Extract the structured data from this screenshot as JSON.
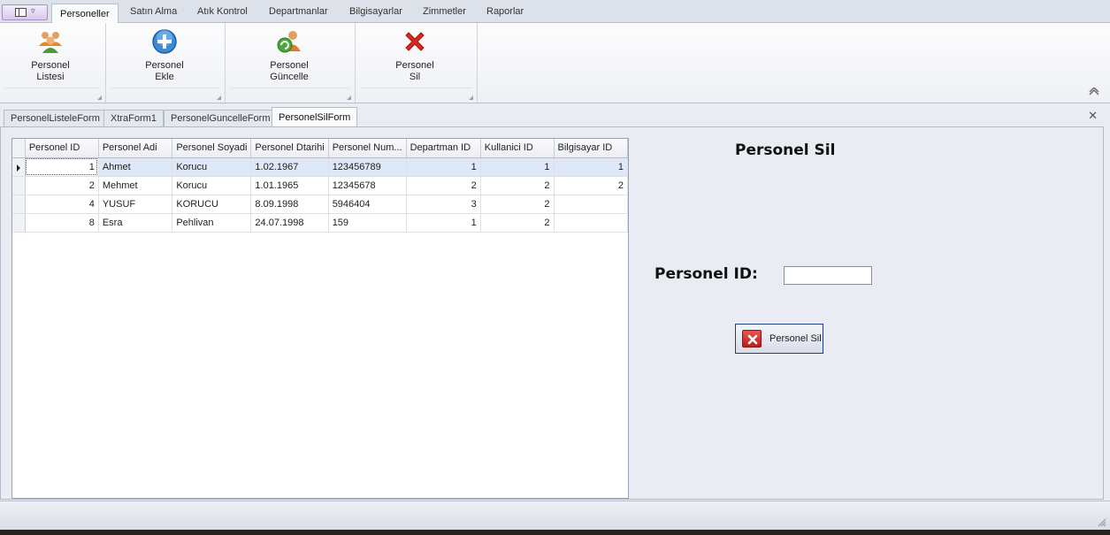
{
  "ribbon": {
    "tabs": [
      "Personeller",
      "Satın Alma",
      "Atık Kontrol",
      "Departmanlar",
      "Bilgisayarlar",
      "Zimmetler",
      "Raporlar"
    ],
    "active_tab": "Personeller",
    "buttons": [
      {
        "label": "Personel\nListesi",
        "icon": "users-icon"
      },
      {
        "label": "Personel\nEkle",
        "icon": "plus-circle-icon"
      },
      {
        "label": "Personel\nGüncelle",
        "icon": "user-refresh-icon"
      },
      {
        "label": "Personel\nSil",
        "icon": "delete-x-icon"
      }
    ]
  },
  "doc_tabs": [
    "PersonelListeleForm",
    "XtraForm1",
    "PersonelGuncelleForm",
    "PersonelSilForm"
  ],
  "active_doc_tab": "PersonelSilForm",
  "grid": {
    "columns": [
      "Personel ID",
      "Personel Adi",
      "Personel Soyadi",
      "Personel Dtarihi",
      "Personel Num...",
      "Departman ID",
      "Kullanici ID",
      "Bilgisayar ID"
    ],
    "rows": [
      [
        "1",
        "Ahmet",
        "Korucu",
        "1.02.1967",
        "123456789",
        "1",
        "1",
        "1"
      ],
      [
        "2",
        "Mehmet",
        "Korucu",
        "1.01.1965",
        "12345678",
        "2",
        "2",
        "2"
      ],
      [
        "4",
        "YUSUF",
        "KORUCU",
        "8.09.1998",
        "5946404",
        "3",
        "2",
        ""
      ],
      [
        "8",
        "Esra",
        "Pehlivan",
        "24.07.1998",
        "159",
        "1",
        "2",
        ""
      ]
    ],
    "selected_row": 0
  },
  "form": {
    "title": "Personel Sil",
    "id_label": "Personel ID:",
    "id_value": "",
    "button_label": "Personel Sil",
    "button_icon": "delete-x-icon"
  },
  "colors": {
    "accent": "#1f3f8f",
    "delete_red": "#c8241f",
    "selection": "#dfe8f7"
  }
}
